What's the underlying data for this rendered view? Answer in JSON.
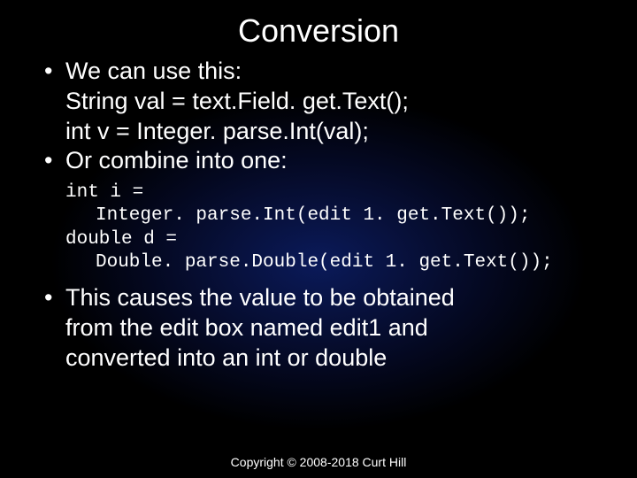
{
  "title": "Conversion",
  "bullets": {
    "b1": {
      "line1": "We can use this:",
      "line2": "String val = text.Field. get.Text();",
      "line3": "int v = Integer. parse.Int(val);"
    },
    "b2": {
      "line1": "Or combine into one:"
    },
    "code": {
      "l1": "int i =",
      "l2": "Integer. parse.Int(edit 1. get.Text());",
      "l3": "double d =",
      "l4": "Double. parse.Double(edit 1. get.Text());"
    },
    "b3": {
      "line1": "This causes the value to be obtained",
      "line2": "from the edit box named edit1 and",
      "line3": "converted into an int or double"
    }
  },
  "footer": "Copyright © 2008-2018 Curt Hill"
}
